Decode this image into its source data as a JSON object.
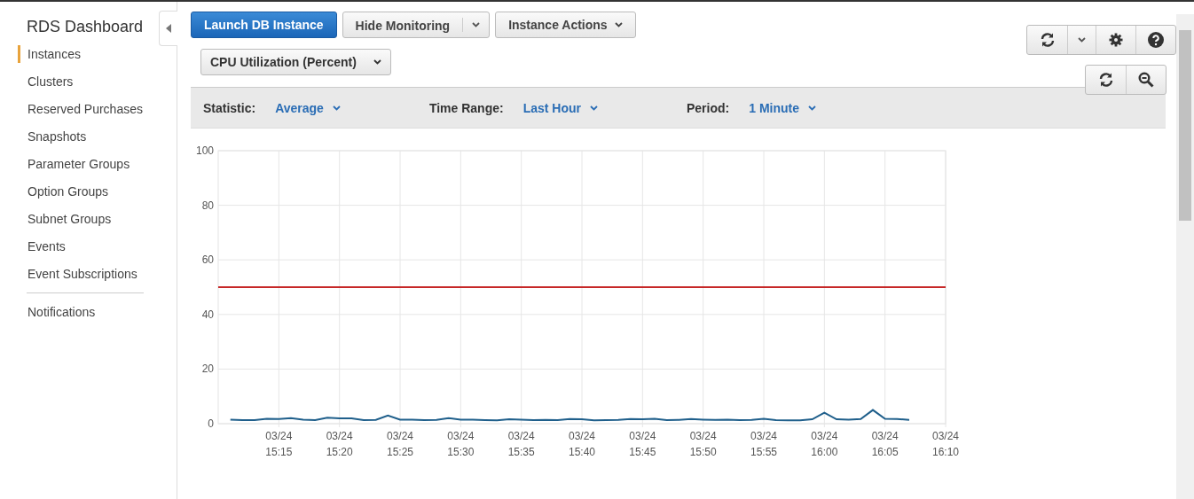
{
  "sidebar": {
    "title": "RDS Dashboard",
    "items": [
      {
        "label": "Instances",
        "selected": true
      },
      {
        "label": "Clusters",
        "selected": false
      },
      {
        "label": "Reserved Purchases",
        "selected": false
      },
      {
        "label": "Snapshots",
        "selected": false
      },
      {
        "label": "Parameter Groups",
        "selected": false
      },
      {
        "label": "Option Groups",
        "selected": false
      },
      {
        "label": "Subnet Groups",
        "selected": false
      },
      {
        "label": "Events",
        "selected": false
      },
      {
        "label": "Event Subscriptions",
        "selected": false
      }
    ],
    "footer_items": [
      {
        "label": "Notifications",
        "selected": false
      }
    ]
  },
  "toolbar": {
    "buttons": [
      {
        "label": "Launch DB Instance",
        "kind": "primary"
      },
      {
        "label": "Hide Monitoring",
        "kind": "split"
      },
      {
        "label": "Instance Actions",
        "kind": "dropdown"
      }
    ]
  },
  "metric_select": {
    "value": "CPU Utilization (Percent)"
  },
  "filters": [
    {
      "label": "Statistic:",
      "value": "Average"
    },
    {
      "label": "Time Range:",
      "value": "Last Hour"
    },
    {
      "label": "Period:",
      "value": "1 Minute"
    }
  ],
  "chart": {
    "chart_data": {
      "type": "line",
      "categories": [
        null,
        null,
        null,
        null,
        null,
        "03/24 15:15",
        null,
        null,
        null,
        null,
        "03/24 15:20",
        null,
        null,
        null,
        null,
        "03/24 15:25",
        null,
        null,
        null,
        null,
        "03/24 15:30",
        null,
        null,
        null,
        null,
        "03/24 15:35",
        null,
        null,
        null,
        null,
        "03/24 15:40",
        null,
        null,
        null,
        null,
        "03/24 15:45",
        null,
        null,
        null,
        null,
        "03/24 15:50",
        null,
        null,
        null,
        null,
        "03/24 15:55",
        null,
        null,
        null,
        null,
        "03/24 16:00",
        null,
        null,
        null,
        null,
        "03/24 16:05",
        null,
        null,
        null,
        null,
        "03/24 16:10"
      ],
      "series": [
        {
          "color": "#1f5f8b",
          "values": [
            null,
            1.5,
            1.3,
            1.3,
            1.8,
            1.7,
            2,
            1.5,
            1.3,
            2.2,
            1.9,
            1.9,
            1.3,
            1.4,
            3,
            1.5,
            1.5,
            1.3,
            1.4,
            2,
            1.5,
            1.5,
            1.3,
            1.2,
            1.6,
            1.5,
            1.3,
            1.4,
            1.3,
            1.7,
            1.6,
            1.2,
            1.3,
            1.4,
            1.7,
            1.6,
            1.8,
            1.3,
            1.4,
            1.7,
            1.5,
            1.4,
            1.5,
            1.3,
            1.4,
            1.8,
            1.3,
            1.2,
            1.2,
            1.6,
            4,
            1.6,
            1.5,
            1.7,
            5,
            1.8,
            1.7,
            1.4,
            null,
            null,
            null
          ]
        },
        {
          "color": "#c62828",
          "values": [
            50,
            50,
            50,
            50,
            50,
            50,
            50,
            50,
            50,
            50,
            50,
            50,
            50,
            50,
            50,
            50,
            50,
            50,
            50,
            50,
            50,
            50,
            50,
            50,
            50,
            50,
            50,
            50,
            50,
            50,
            50,
            50,
            50,
            50,
            50,
            50,
            50,
            50,
            50,
            50,
            50,
            50,
            50,
            50,
            50,
            50,
            50,
            50,
            50,
            50,
            50,
            50,
            50,
            50,
            50,
            50,
            50,
            50,
            50,
            50,
            50
          ]
        }
      ],
      "ylim": [
        0,
        100
      ],
      "grid": true,
      "yticks": [
        0,
        20,
        40,
        60,
        80,
        100
      ]
    }
  }
}
